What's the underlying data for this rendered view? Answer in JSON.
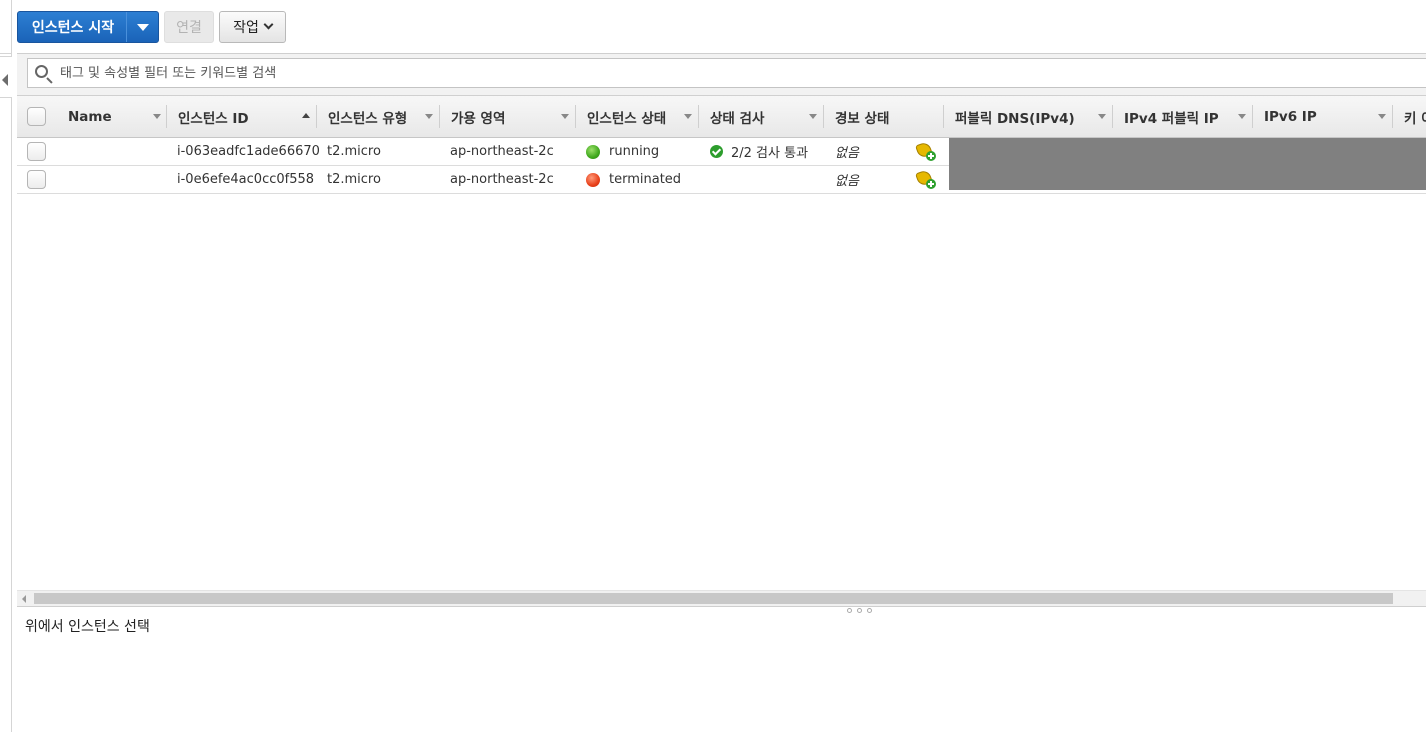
{
  "toolbar": {
    "launch_label": "인스턴스 시작",
    "connect_label": "연결",
    "actions_label": "작업"
  },
  "search": {
    "placeholder": "태그 및 속성별 필터 또는 키워드별 검색"
  },
  "table": {
    "columns": [
      {
        "label": "Name"
      },
      {
        "label": "인스턴스 ID",
        "sort": "asc"
      },
      {
        "label": "인스턴스 유형"
      },
      {
        "label": "가용 영역"
      },
      {
        "label": "인스턴스 상태"
      },
      {
        "label": "상태 검사"
      },
      {
        "label": "경보 상태"
      },
      {
        "label": "퍼블릭 DNS(IPv4)"
      },
      {
        "label": "IPv4 퍼블릭 IP"
      },
      {
        "label": "IPv6 IP"
      },
      {
        "label": "키 이"
      }
    ],
    "rows": [
      {
        "name": "",
        "instance_id": "i-063eadfc1ade66670",
        "instance_type": "t2.micro",
        "availability_zone": "ap-northeast-2c",
        "state": "running",
        "state_color": "green",
        "status_check": "2/2 검사 통과",
        "alarm_status": "없음"
      },
      {
        "name": "",
        "instance_id": "i-0e6efe4ac0cc0f558",
        "instance_type": "t2.micro",
        "availability_zone": "ap-northeast-2c",
        "state": "terminated",
        "state_color": "red",
        "status_check": "",
        "alarm_status": "없음"
      }
    ]
  },
  "detail_panel": {
    "message": "위에서 인스턴스 선택"
  },
  "colors": {
    "primary": "#1a63b8",
    "running": "#3fa81d",
    "terminated": "#e8401a",
    "redacted": "#808080"
  }
}
